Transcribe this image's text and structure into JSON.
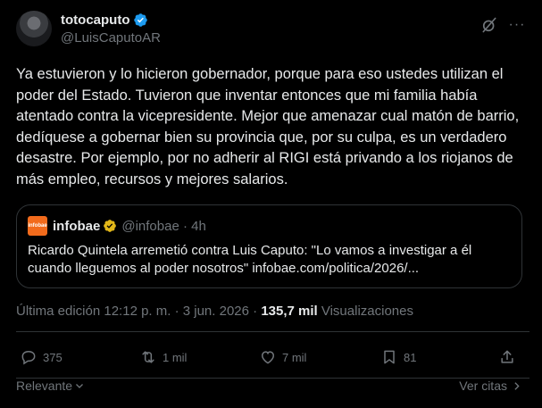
{
  "author": {
    "display_name": "totocaputo",
    "handle": "@LuisCaputoAR"
  },
  "tweet": {
    "text": "Ya estuvieron y lo hicieron gobernador, porque para eso ustedes utilizan el poder del Estado. Tuvieron que inventar entonces que mi familia había atentado contra la vicepresidente. Mejor que amenazar cual matón de barrio, dedíquese a gobernar bien su provincia que, por su culpa, es un verdadero desastre. Por ejemplo, por no adherir al RIGI está privando a los riojanos de más empleo, recursos y mejores salarios."
  },
  "quote": {
    "logo_text": "infobae",
    "name": "infobae",
    "handle_time": "@infobae · 4h",
    "text": "Ricardo Quintela arremetió contra Luis Caputo: \"Lo vamos a investigar a él cuando lleguemos al poder nosotros\" infobae.com/politica/2026/..."
  },
  "meta": {
    "edited": "Última edición 12:12 p. m. · 3 jun. 2026 · ",
    "views_count": "135,7 mil",
    "views_label": " Visualizaciones"
  },
  "actions": {
    "replies": "375",
    "reposts": "1 mil",
    "likes": "7 mil",
    "bookmarks": "81"
  },
  "footer": {
    "sort_label": "Relevante",
    "quotes_link": "Ver citas"
  },
  "colors": {
    "background": "#000000",
    "text": "#e7e9ea",
    "muted": "#71767b",
    "border": "#2f3336",
    "verified_badge": "#1d9bf0",
    "quote_verified_badge": "#e2b719",
    "infobae_orange": "#f26b1c"
  }
}
